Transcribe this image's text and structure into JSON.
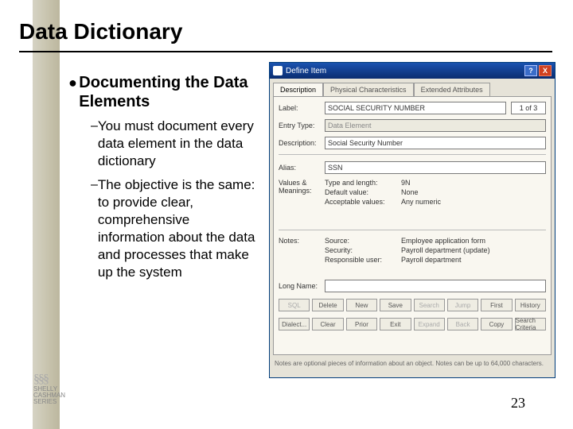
{
  "slide": {
    "title": "Data Dictionary",
    "bullet_main": "Documenting the Data Elements",
    "sub1": "You must document every data element in the data dictionary",
    "sub2": "The objective is the same: to provide clear, comprehensive information about the data and processes that make up the system",
    "page_number": "23",
    "logo_line1": "SHELLY",
    "logo_line2": "CASHMAN",
    "logo_line3": "SERIES"
  },
  "dialog": {
    "title": "Define Item",
    "help_btn": "?",
    "close_btn": "X",
    "tabs": [
      "Description",
      "Physical Characteristics",
      "Extended Attributes"
    ],
    "label_lbl": "Label:",
    "label_val": "SOCIAL SECURITY NUMBER",
    "counter": "1 of 3",
    "entry_lbl": "Entry Type:",
    "entry_val": "Data Element",
    "desc_lbl": "Description:",
    "desc_val": "Social Security Number",
    "alias_lbl": "Alias:",
    "alias_val": "SSN",
    "values_lbl": "Values &\nMeanings:",
    "kv": [
      {
        "k": "Type and length:",
        "v": "9N"
      },
      {
        "k": "Default value:",
        "v": "None"
      },
      {
        "k": "Acceptable values:",
        "v": "Any numeric"
      }
    ],
    "notes_lbl": "Notes:",
    "notes_kv": [
      {
        "k": "Source:",
        "v": "Employee application form"
      },
      {
        "k": "Security:",
        "v": "Payroll department (update)"
      },
      {
        "k": "Responsible user:",
        "v": "Payroll department"
      }
    ],
    "long_lbl": "Long Name:",
    "btn_row1": [
      "SQL",
      "Delete",
      "New",
      "Save",
      "Search",
      "Jump",
      "First",
      "History"
    ],
    "btn_row2": [
      "Dialect...",
      "Clear",
      "Prior",
      "Exit",
      "Expand",
      "Back",
      "Copy",
      "Search Criteria"
    ],
    "footnote": "Notes are optional pieces of information about an object. Notes can be up to 64,000 characters."
  }
}
